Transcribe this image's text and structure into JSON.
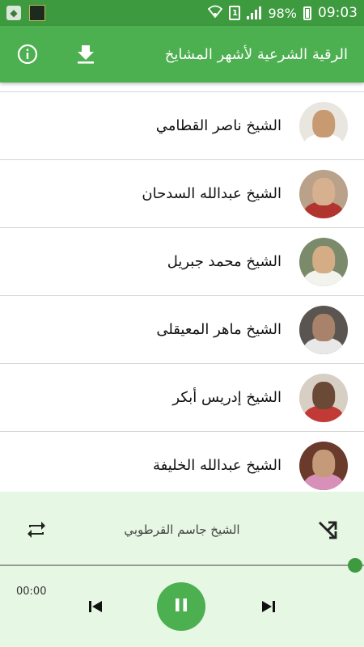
{
  "status_bar": {
    "battery": "98%",
    "time": "09:03",
    "sim_label": "1"
  },
  "app_bar": {
    "title": "الرقية الشرعية لأشهر المشايخ",
    "download_icon": "download-icon",
    "info_icon": "info-icon"
  },
  "list": {
    "items": [
      {
        "name": "الشيخ ناصر القطامي",
        "avatar_bg": "#e9e6e0",
        "face": "#c89a72",
        "cloth": "#ffffff"
      },
      {
        "name": "الشيخ عبدالله السدحان",
        "avatar_bg": "#b9a18a",
        "face": "#d6b08f",
        "cloth": "#b2342f"
      },
      {
        "name": "الشيخ محمد جبريل",
        "avatar_bg": "#7a8a6a",
        "face": "#d4ad86",
        "cloth": "#f3f3ee"
      },
      {
        "name": "الشيخ ماهر المعيقلى",
        "avatar_bg": "#5a5550",
        "face": "#a8826a",
        "cloth": "#e8e8e8"
      },
      {
        "name": "الشيخ إدريس أبكر",
        "avatar_bg": "#d8cfc4",
        "face": "#6a4a36",
        "cloth": "#c23a36"
      },
      {
        "name": "الشيخ عبدالله الخليفة",
        "avatar_bg": "#6a3a2a",
        "face": "#c49a78",
        "cloth": "#d890b8"
      }
    ]
  },
  "player": {
    "track_title": "الشيخ جاسم القرطوبي",
    "elapsed": "00:00",
    "progress": 1.0,
    "accent": "#4caf50",
    "repeat_icon": "repeat-icon",
    "shuffle_icon": "shuffle-icon",
    "prev_icon": "skip-previous-icon",
    "pause_icon": "pause-icon",
    "next_icon": "skip-next-icon"
  }
}
